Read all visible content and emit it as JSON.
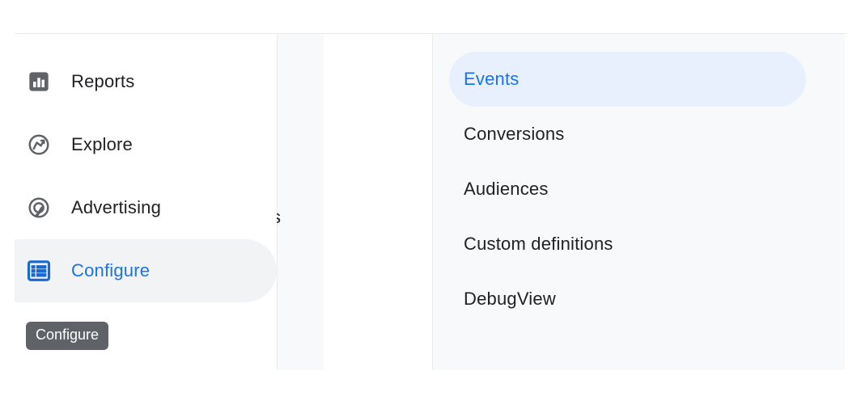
{
  "sidebar": {
    "items": [
      {
        "label": "Reports"
      },
      {
        "label": "Explore"
      },
      {
        "label": "Advertising"
      },
      {
        "label": "Configure"
      }
    ],
    "tooltip": "Configure"
  },
  "submenu": {
    "items": [
      {
        "label": "Events"
      },
      {
        "label": "Conversions"
      },
      {
        "label": "Audiences"
      },
      {
        "label": "Custom definitions"
      },
      {
        "label": "DebugView"
      }
    ]
  },
  "peek_char": "s"
}
